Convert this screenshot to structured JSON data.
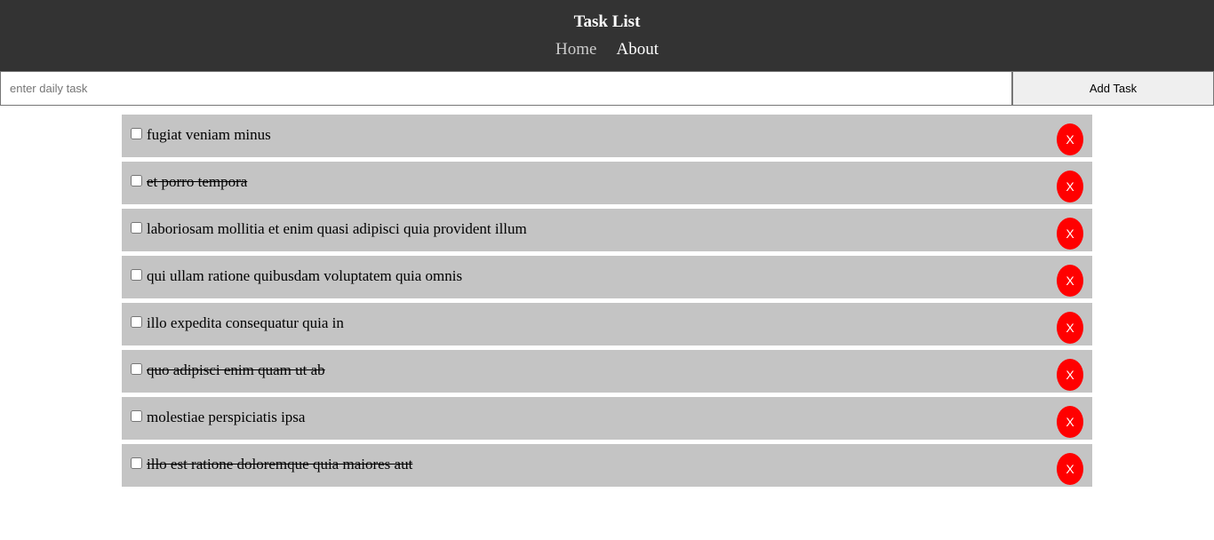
{
  "header": {
    "title": "Task List",
    "nav": [
      {
        "label": "Home"
      },
      {
        "label": "About"
      }
    ]
  },
  "form": {
    "placeholder": "enter daily task",
    "value": "",
    "submit_label": "Add Task"
  },
  "colors": {
    "header_bg": "#333333",
    "item_bg": "#c4c4c4",
    "delete_bg": "#ff0000"
  },
  "tasks": [
    {
      "title": "fugiat veniam minus",
      "completed": false,
      "delete_label": "X"
    },
    {
      "title": "et porro tempora",
      "completed": true,
      "delete_label": "X"
    },
    {
      "title": "laboriosam mollitia et enim quasi adipisci quia provident illum",
      "completed": false,
      "delete_label": "X"
    },
    {
      "title": "qui ullam ratione quibusdam voluptatem quia omnis",
      "completed": false,
      "delete_label": "X"
    },
    {
      "title": "illo expedita consequatur quia in",
      "completed": false,
      "delete_label": "X"
    },
    {
      "title": "quo adipisci enim quam ut ab",
      "completed": true,
      "delete_label": "X"
    },
    {
      "title": "molestiae perspiciatis ipsa",
      "completed": false,
      "delete_label": "X"
    },
    {
      "title": "illo est ratione doloremque quia maiores aut",
      "completed": true,
      "delete_label": "X"
    }
  ]
}
